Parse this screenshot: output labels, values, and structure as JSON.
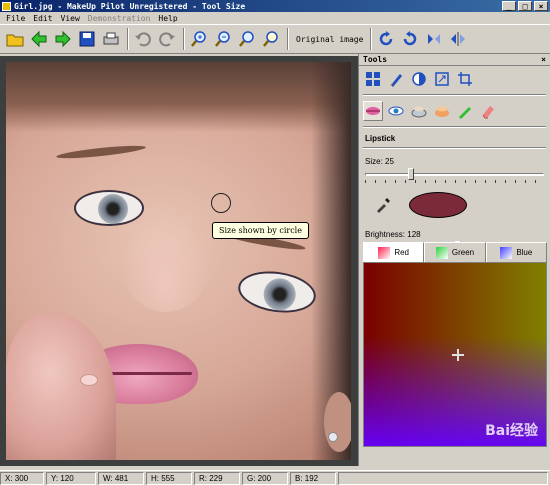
{
  "window": {
    "title": "Girl.jpg - MakeUp Pilot Unregistered - Tool Size",
    "min": "_",
    "max": "□",
    "close": "×"
  },
  "menu": [
    "File",
    "Edit",
    "View",
    "Demonstration",
    "Help"
  ],
  "toolbar": {
    "original_image_label": "Original image",
    "icons": [
      "open-icon",
      "back-icon",
      "forward-icon",
      "save-icon",
      "print-icon",
      "undo-icon",
      "redo-icon",
      "zoom-in-icon",
      "zoom-out-icon",
      "zoom-fit-icon",
      "zoom-actual-icon",
      "rotate-right-icon",
      "rotate-left-icon",
      "flip-vertical-icon",
      "flip-horizontal-icon"
    ]
  },
  "canvas": {
    "tooltip": "Size shown by circle"
  },
  "tools": {
    "header": "Tools",
    "close": "×",
    "section_title": "Lipstick",
    "size_label": "Size: 25",
    "size_value": 25,
    "brightness_label": "Brightness: 128",
    "brightness_value": 128,
    "swatch_color": "#7a2a38",
    "tabs": [
      {
        "label": "Red",
        "icon_color": "#ff2050"
      },
      {
        "label": "Green",
        "icon_color": "#30d040"
      },
      {
        "label": "Blue",
        "icon_color": "#4040ff"
      }
    ],
    "active_tab": "Red",
    "watermark": "Bai经验"
  },
  "status": {
    "x": "X: 300",
    "y": "Y: 120",
    "w": "W: 481",
    "h": "H: 555",
    "r": "R: 229",
    "g": "G: 200",
    "b": "B: 192"
  }
}
